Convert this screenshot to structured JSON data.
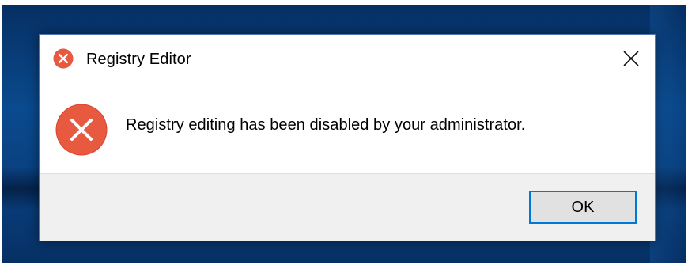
{
  "dialog": {
    "title": "Registry Editor",
    "message": "Registry editing has been disabled by your administrator.",
    "ok_label": "OK",
    "icons": {
      "title_icon": "error-icon",
      "message_icon": "error-icon",
      "close_icon": "close-icon"
    }
  },
  "colors": {
    "error_red": "#e04a33",
    "button_focus_border": "#0078d7",
    "button_face": "#e1e1e1",
    "footer_bg": "#f0f0f0",
    "desktop_blue": "#0a4a8e"
  }
}
